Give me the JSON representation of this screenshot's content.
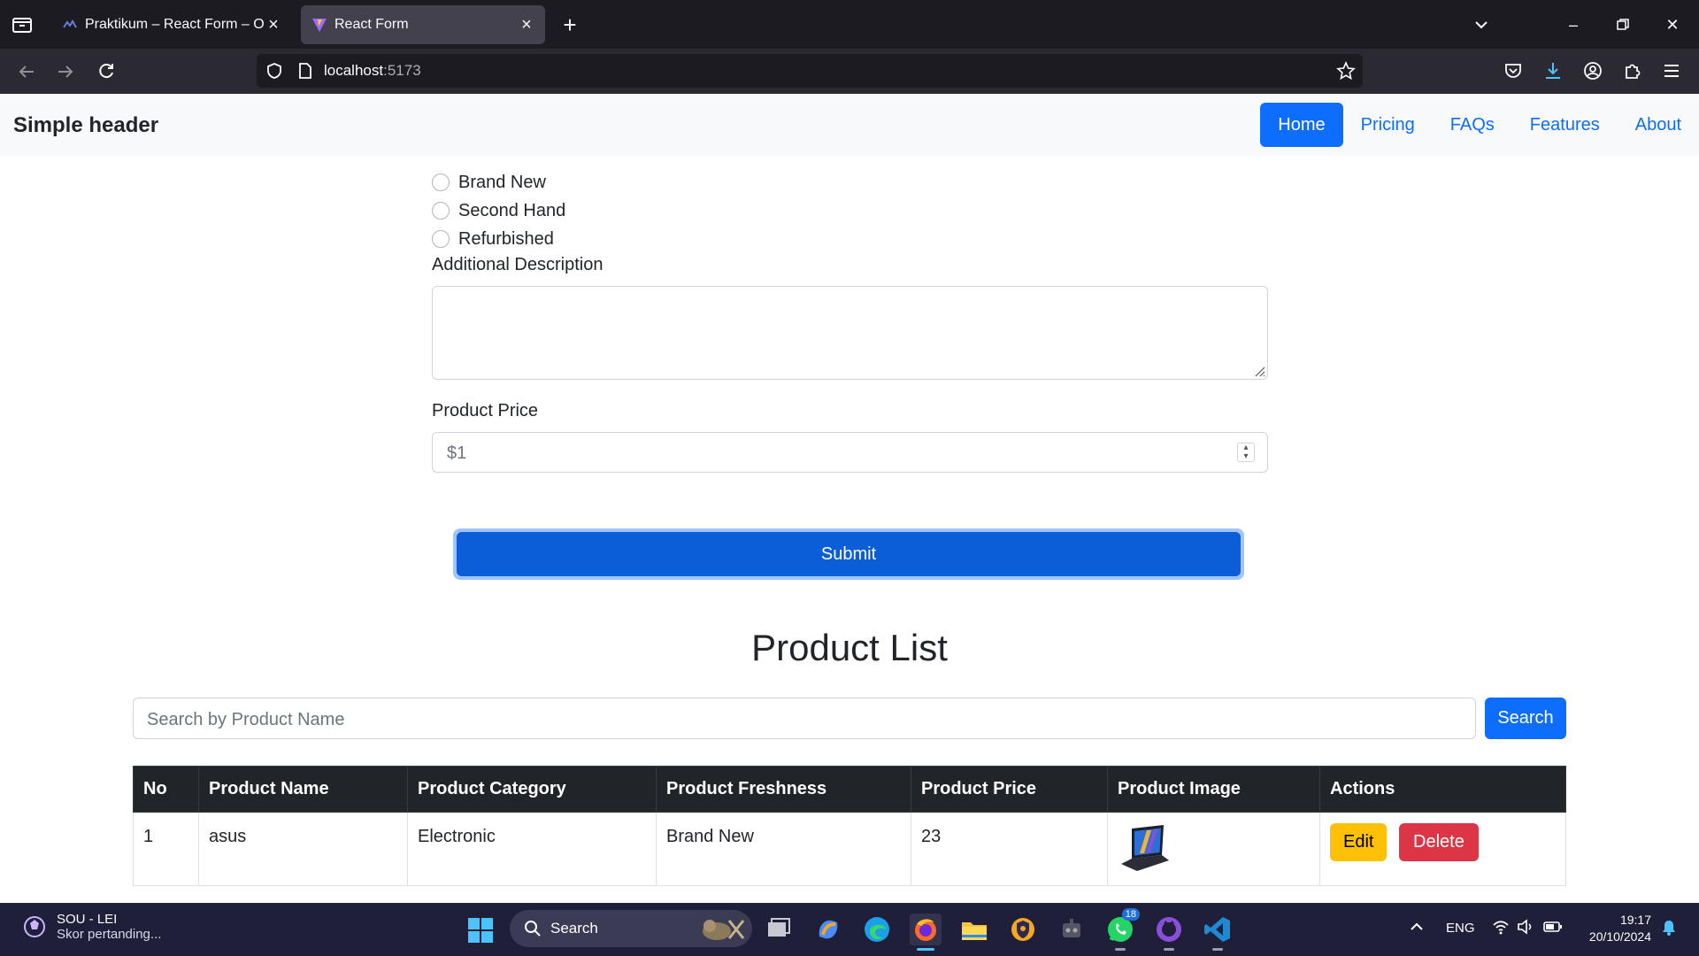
{
  "browser": {
    "tabs": [
      {
        "title": "Praktikum – React Form – ONE |",
        "active": false
      },
      {
        "title": "React Form",
        "active": true
      }
    ],
    "url_host": "localhost",
    "url_port": ":5173"
  },
  "header": {
    "brand": "Simple header",
    "nav": [
      "Home",
      "Pricing",
      "FAQs",
      "Features",
      "About"
    ],
    "active_nav": "Home"
  },
  "form": {
    "freshness_options": [
      "Brand New",
      "Second Hand",
      "Refurbished"
    ],
    "description_label": "Additional Description",
    "description_value": "",
    "price_label": "Product Price",
    "price_value": "$1",
    "submit_label": "Submit"
  },
  "product_list": {
    "title": "Product List",
    "search_placeholder": "Search by Product Name",
    "search_button": "Search",
    "columns": [
      "No",
      "Product Name",
      "Product Category",
      "Product Freshness",
      "Product Price",
      "Product Image",
      "Actions"
    ],
    "rows": [
      {
        "no": "1",
        "name": "asus",
        "category": "Electronic",
        "freshness": "Brand New",
        "price": "23"
      }
    ],
    "edit_label": "Edit",
    "delete_label": "Delete"
  },
  "taskbar": {
    "widget_title": "SOU - LEI",
    "widget_subtitle": "Skor pertanding...",
    "search_label": "Search",
    "whatsapp_badge": "18",
    "language": "ENG",
    "time": "19:17",
    "date": "20/10/2024"
  },
  "colors": {
    "primary": "#0d6efd",
    "warning": "#ffc107",
    "danger": "#dc3545",
    "table_header": "#212529"
  }
}
